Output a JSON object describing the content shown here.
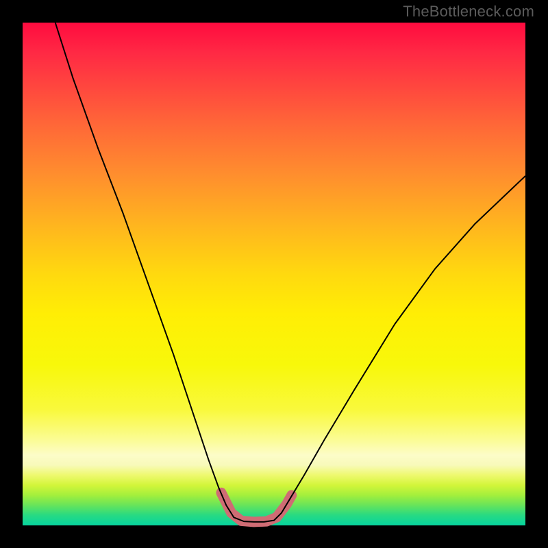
{
  "watermark": {
    "text": "TheBottleneck.com"
  },
  "chart_data": {
    "type": "line",
    "title": "",
    "xlabel": "",
    "ylabel": "",
    "xlim": [
      0,
      100
    ],
    "ylim": [
      0,
      100
    ],
    "grid": false,
    "legend": false,
    "series": [
      {
        "name": "bottleneck-curve",
        "stroke": "#000000",
        "stroke_width": 2,
        "points": [
          {
            "x": 6.5,
            "y": 100.0
          },
          {
            "x": 10.0,
            "y": 89.0
          },
          {
            "x": 15.0,
            "y": 75.0
          },
          {
            "x": 20.0,
            "y": 62.0
          },
          {
            "x": 25.0,
            "y": 48.0
          },
          {
            "x": 30.0,
            "y": 34.0
          },
          {
            "x": 34.0,
            "y": 22.0
          },
          {
            "x": 37.0,
            "y": 13.0
          },
          {
            "x": 39.0,
            "y": 7.5
          },
          {
            "x": 40.5,
            "y": 4.0
          },
          {
            "x": 42.0,
            "y": 1.6
          },
          {
            "x": 44.0,
            "y": 0.8
          },
          {
            "x": 46.0,
            "y": 0.7
          },
          {
            "x": 48.0,
            "y": 0.7
          },
          {
            "x": 50.0,
            "y": 1.0
          },
          {
            "x": 51.5,
            "y": 2.5
          },
          {
            "x": 53.0,
            "y": 5.0
          },
          {
            "x": 56.0,
            "y": 10.0
          },
          {
            "x": 60.0,
            "y": 17.0
          },
          {
            "x": 66.0,
            "y": 27.0
          },
          {
            "x": 74.0,
            "y": 40.0
          },
          {
            "x": 82.0,
            "y": 51.0
          },
          {
            "x": 90.0,
            "y": 60.0
          },
          {
            "x": 100.0,
            "y": 69.5
          }
        ]
      },
      {
        "name": "highlight-band",
        "stroke": "#cf6c74",
        "stroke_width": 15,
        "linecap": "round",
        "points": [
          {
            "x": 39.5,
            "y": 6.5
          },
          {
            "x": 41.5,
            "y": 2.5
          },
          {
            "x": 43.5,
            "y": 0.9
          },
          {
            "x": 46.0,
            "y": 0.7
          },
          {
            "x": 48.5,
            "y": 0.8
          },
          {
            "x": 50.5,
            "y": 1.6
          },
          {
            "x": 52.5,
            "y": 4.2
          },
          {
            "x": 53.5,
            "y": 6.0
          }
        ]
      }
    ],
    "background_gradient_stops": [
      {
        "pos": 0.0,
        "color": "#ff0b3f"
      },
      {
        "pos": 0.5,
        "color": "#ffd90f"
      },
      {
        "pos": 0.83,
        "color": "#fbfc95"
      },
      {
        "pos": 1.0,
        "color": "#06d49e"
      }
    ]
  }
}
